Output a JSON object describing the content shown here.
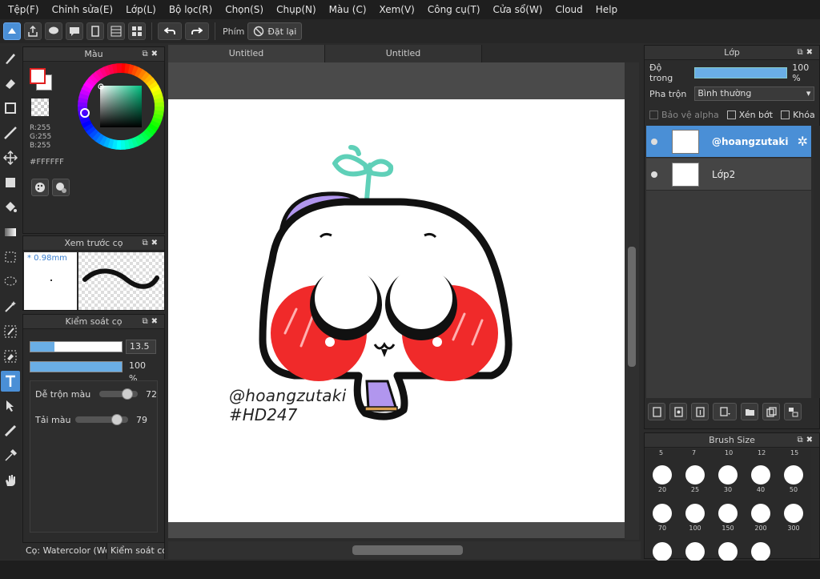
{
  "menu": [
    "Tệp(F)",
    "Chỉnh sửa(E)",
    "Lớp(L)",
    "Bộ lọc(R)",
    "Chọn(S)",
    "Chụp(N)",
    "Màu (C)",
    "Xem(V)",
    "Công cụ(T)",
    "Cửa sổ(W)",
    "Cloud",
    "Help"
  ],
  "toolbar": {
    "shortcut_label": "Phím",
    "reset_label": "Đặt lại"
  },
  "color_panel": {
    "title": "Màu",
    "rgb": [
      "R:255",
      "G:255",
      "B:255"
    ],
    "hex": "#FFFFFF",
    "fg_color": "#ffffff",
    "accent_color": "#e02020"
  },
  "preview_panel": {
    "title": "Xem trước cọ",
    "size": "* 0.98mm"
  },
  "brush_control": {
    "title": "Kiểm soát cọ",
    "size_value": "13.5",
    "size_fill": 0.26,
    "opacity_value": "100 %",
    "opacity_fill": 1.0,
    "blend_label": "Dễ trộn màu",
    "blend_value": "72",
    "blend_fill": 0.72,
    "pickup_label": "Tải màu",
    "pickup_value": "79",
    "pickup_fill": 0.79
  },
  "left_tabs": [
    "Cọ: Watercolor (Wet",
    "Kiểm soát cọ"
  ],
  "doc_tabs": [
    "Untitled",
    "Untitled"
  ],
  "canvas": {
    "credit_line1": "@hoangzutaki",
    "credit_line2": "#HD247"
  },
  "layer_panel": {
    "title": "Lớp",
    "opacity_label": "Độ trong",
    "opacity_value": "100 %",
    "opacity_fill": 1.0,
    "blend_label": "Pha trộn",
    "blend_value": "Bình thường",
    "alpha_label": "Bảo vệ alpha",
    "clip_label": "Xén bớt",
    "lock_label": "Khóa",
    "layers": [
      {
        "name": "@hoangzutaki",
        "selected": true
      },
      {
        "name": "Lớp2",
        "selected": false
      }
    ]
  },
  "brush_size_panel": {
    "title": "Brush Size",
    "top_labels": [
      "5",
      "7",
      "10",
      "12",
      "15"
    ],
    "rows": [
      [
        "20",
        "25",
        "30",
        "40",
        "50"
      ],
      [
        "70",
        "100",
        "150",
        "200",
        "300"
      ],
      [
        "",
        "",
        "",
        ""
      ]
    ]
  }
}
